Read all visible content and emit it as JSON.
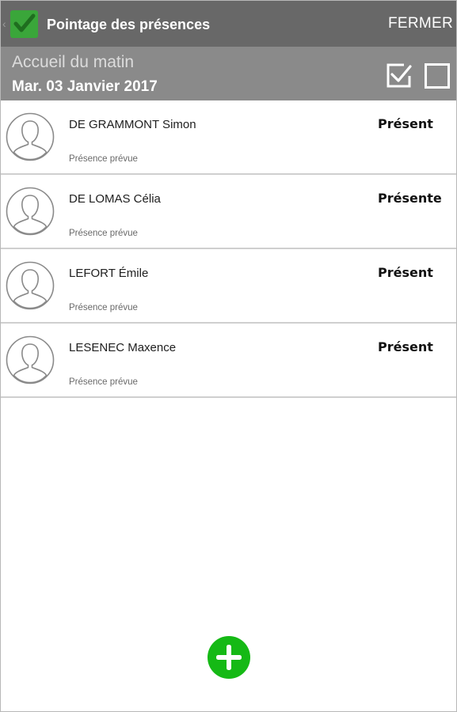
{
  "header": {
    "back_icon": "chevron-left-icon",
    "logo_icon": "green-checkbox-logo-icon",
    "title": "Pointage des présences",
    "close_label": "FERMER",
    "back_glyph": "‹"
  },
  "session": {
    "title": "Accueil du matin",
    "date": "Mar. 03 Janvier 2017",
    "check_all_icon": "checked-box-icon",
    "uncheck_all_icon": "empty-box-icon"
  },
  "children": [
    {
      "name": "DE GRAMMONT Simon",
      "note": "Présence prévue",
      "status": "Présent",
      "avatar": "user-silhouette-icon"
    },
    {
      "name": "DE LOMAS Célia",
      "note": "Présence prévue",
      "status": "Présente",
      "avatar": "user-silhouette-icon"
    },
    {
      "name": "LEFORT Émile",
      "note": "Présence prévue",
      "status": "Présent",
      "avatar": "user-silhouette-icon"
    },
    {
      "name": "LESENEC Maxence",
      "note": "Présence prévue",
      "status": "Présent",
      "avatar": "user-silhouette-icon"
    }
  ],
  "fab": {
    "icon": "plus-icon"
  },
  "colors": {
    "topbar": "#686868",
    "subheader": "#8a8a8a",
    "logo_green": "#3aa63a",
    "fab_green": "#15b915"
  }
}
